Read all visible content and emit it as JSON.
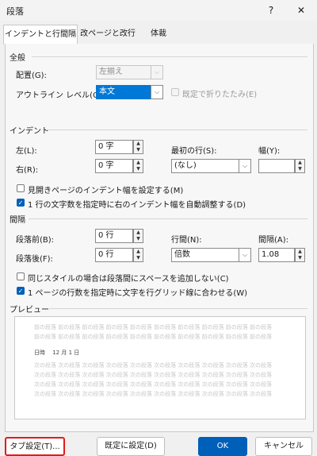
{
  "window": {
    "title": "段落",
    "help": "?",
    "close": "✕"
  },
  "tabs": [
    {
      "label": "インデントと行間隔",
      "active": true
    },
    {
      "label": "改ページと改行",
      "active": false
    },
    {
      "label": "体裁",
      "active": false
    }
  ],
  "general": {
    "section": "全般",
    "alignment_label": "配置(G):",
    "alignment_value": "左揃え",
    "outline_label": "アウトライン レベル(O):",
    "outline_value": "本文",
    "collapse_label": "既定で折りたたみ(E)"
  },
  "indent": {
    "section": "インデント",
    "left_label": "左(L):",
    "left_value": "0 字",
    "right_label": "右(R):",
    "right_value": "0 字",
    "first_line_label": "最初の行(S):",
    "first_line_value": "(なし)",
    "width_label": "幅(Y):",
    "width_value": "",
    "mirror_label": "見開きページのインデント幅を設定する(M)",
    "auto_adjust_label": "1 行の文字数を指定時に右のインデント幅を自動調整する(D)"
  },
  "spacing": {
    "section": "間隔",
    "before_label": "段落前(B):",
    "before_value": "0 行",
    "after_label": "段落後(F):",
    "after_value": "0 行",
    "line_spacing_label": "行間(N):",
    "line_spacing_value": "倍数",
    "at_label": "間隔(A):",
    "at_value": "1.08",
    "no_space_label": "同じスタイルの場合は段落間にスペースを追加しない(C)",
    "snap_grid_label": "1 ページの行数を指定時に文字を行グリッド線に合わせる(W)"
  },
  "preview": {
    "section": "プレビュー",
    "prev_text": "前の段落 前の段落 前の段落 前の段落 前の段落 前の段落 前の段落 前の段落 前の段落 前の段落",
    "sample_text": "日時　 12 月 1 日",
    "next_text": "次の段落 次の段落 次の段落 次の段落 次の段落 次の段落 次の段落 次の段落 次の段落 次の段落"
  },
  "buttons": {
    "tabs": "タブ設定(T)...",
    "set_default": "既定に設定(D)",
    "ok": "OK",
    "cancel": "キャンセル"
  },
  "colors": {
    "accent": "#005fb8",
    "highlight": "#e01c1c",
    "selection": "#0078d7"
  }
}
